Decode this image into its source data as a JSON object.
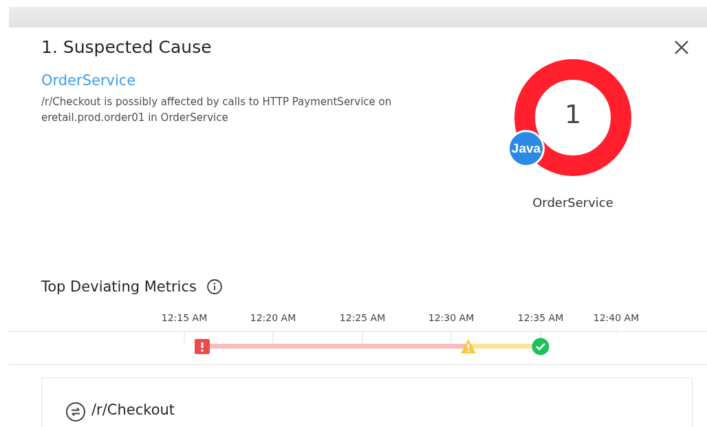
{
  "dialog": {
    "title": "1. Suspected Cause",
    "service_link": "OrderService",
    "description": "/r/Checkout is possibly affected by calls to HTTP PaymentService on eretail.prod.order01 in OrderService"
  },
  "service_node": {
    "count": "1",
    "badge": "Java",
    "label": "OrderService",
    "color": "#ff1f2d"
  },
  "metrics": {
    "title": "Top Deviating Metrics",
    "timeline": {
      "ticks": [
        "12:15 AM",
        "12:20 AM",
        "12:25 AM",
        "12:30 AM",
        "12:35 AM",
        "12:40 AM"
      ],
      "events": [
        {
          "kind": "critical"
        },
        {
          "kind": "warning"
        },
        {
          "kind": "ok"
        }
      ]
    },
    "cards": [
      {
        "name": "/r/Checkout"
      }
    ]
  }
}
